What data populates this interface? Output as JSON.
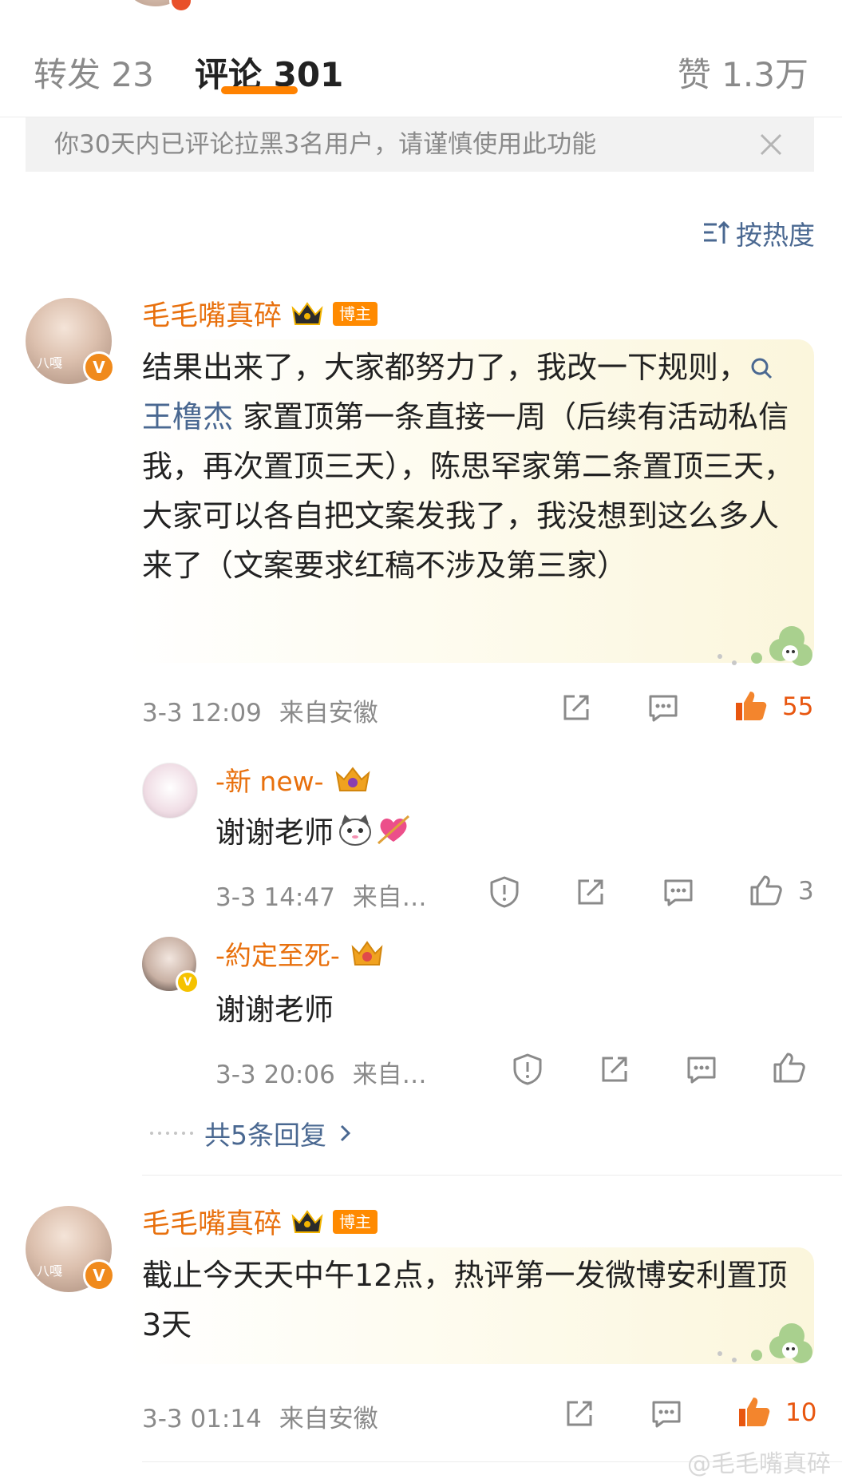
{
  "tabs": {
    "repost": "转发 23",
    "comment": "评论 301",
    "like": "赞 1.3万"
  },
  "notice": {
    "text": "你30天内已评论拉黑3名用户，请谨慎使用此功能"
  },
  "sort": {
    "label": "按热度"
  },
  "comments": [
    {
      "author": "毛毛嘴真碎",
      "host_tag": "博主",
      "avatar_label": "八嘎",
      "text_before": "结果出来了，大家都努力了，我改一下规则，",
      "topic": "王橹杰",
      "text_after": " 家置顶第一条直接一周（后续有活动私信我，再次置顶三天），陈思罕家第二条置顶三天，大家可以各自把文案发我了，我没想到这么多人来了（文案要求红稿不涉及第三家）",
      "time": "3-3 12:09",
      "location": "来自安徽",
      "likes": "55",
      "replies": [
        {
          "author": "-新 new-",
          "text": "谢谢老师",
          "time": "3-3 14:47",
          "location": "来自…",
          "likes": "3"
        },
        {
          "author": "-約定至死-",
          "text": "谢谢老师",
          "time": "3-3 20:06",
          "location": "来自…",
          "likes": ""
        }
      ],
      "more_replies": "共5条回复"
    },
    {
      "author": "毛毛嘴真碎",
      "host_tag": "博主",
      "avatar_label": "八嘎",
      "text": "截止今天天中午12点，热评第一发微博安利置顶3天",
      "time": "3-3 01:14",
      "location": "来自安徽",
      "likes": "10"
    }
  ],
  "watermark": "@毛毛嘴真碎",
  "colors": {
    "accent": "#ff8200",
    "name": "#e8700d",
    "link": "#4a6891",
    "like_active": "#e8560f",
    "meta": "#8a8a8a"
  }
}
